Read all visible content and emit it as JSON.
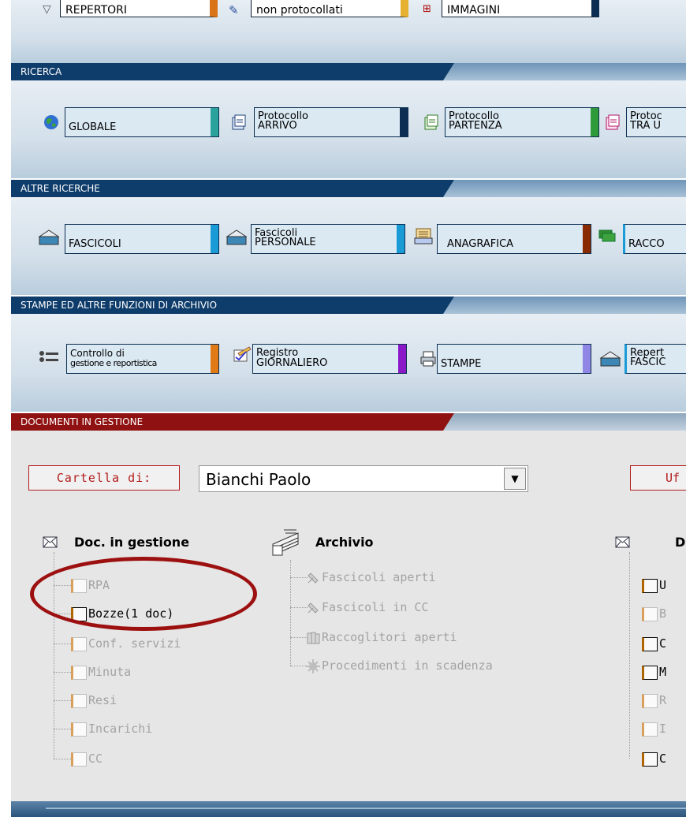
{
  "top_row": [
    {
      "label": "REPERTORI"
    },
    {
      "label": "non protocollati"
    },
    {
      "label": "IMMAGINI"
    }
  ],
  "sections": {
    "ricerca": {
      "title": "RICERCA",
      "buttons": [
        {
          "line1": "GLOBALE",
          "line2": ""
        },
        {
          "line1": "Protocollo",
          "line2": "ARRIVO"
        },
        {
          "line1": "Protocollo",
          "line2": "PARTENZA"
        },
        {
          "line1": "Protoc",
          "line2": "TRA U"
        }
      ]
    },
    "altre": {
      "title": "ALTRE RICERCHE",
      "buttons": [
        {
          "line1": "FASCICOLI",
          "line2": ""
        },
        {
          "line1": "Fascicoli",
          "line2": "PERSONALE"
        },
        {
          "line1": "ANAGRAFICA",
          "line2": ""
        },
        {
          "line1": "RACCO",
          "line2": ""
        }
      ]
    },
    "stampe": {
      "title": "STAMPE ED ALTRE FUNZIONI DI ARCHIVIO",
      "buttons": [
        {
          "line1": "Controllo di",
          "line2": "gestione e reportistica"
        },
        {
          "line1": "Registro",
          "line2": "GIORNALIERO"
        },
        {
          "line1": "STAMPE",
          "line2": ""
        },
        {
          "line1": "Repert",
          "line2": "FASCIC"
        }
      ]
    },
    "documenti": {
      "title": "DOCUMENTI IN GESTIONE"
    }
  },
  "cartella": {
    "label": "Cartella di:",
    "selected": "Bianchi Paolo",
    "uff_label": "Uf"
  },
  "doc_tree": {
    "title": "Doc. in gestione",
    "items": [
      {
        "label": "RPA",
        "active": false
      },
      {
        "label": "Bozze(1 doc)",
        "active": true
      },
      {
        "label": "Conf. servizi",
        "active": false
      },
      {
        "label": "Minuta",
        "active": false
      },
      {
        "label": "Resi",
        "active": false
      },
      {
        "label": "Incarichi",
        "active": false
      },
      {
        "label": "CC",
        "active": false
      }
    ]
  },
  "archivio": {
    "title": "Archivio",
    "items": [
      {
        "label": "Fascicoli aperti"
      },
      {
        "label": "Fascicoli in CC"
      },
      {
        "label": "Raccoglitori aperti"
      },
      {
        "label": "Procedimenti in scadenza"
      }
    ]
  },
  "right_tree": {
    "title": "D",
    "items": [
      "U",
      "B",
      "C",
      "M",
      "R",
      "I",
      "C"
    ]
  },
  "colors": {
    "header_blue": "#0f3d6b",
    "header_red": "#8f1111",
    "highlight_red": "#9d1010"
  }
}
